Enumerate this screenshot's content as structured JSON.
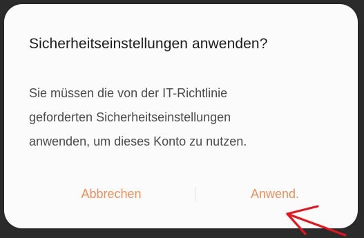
{
  "dialog": {
    "title": "Sicherheitseinstellungen anwenden?",
    "message_lines": [
      "Sie müssen die von der IT-Richtlinie",
      "geforderten Sicherheitseinstellungen",
      "anwenden, um dieses Konto zu nutzen."
    ],
    "cancel_label": "Abbrechen",
    "apply_label": "Anwend."
  },
  "colors": {
    "accent": "#ec8f58",
    "annotation_arrow": "#e8141c",
    "dialog_background": "#fbfbfb"
  },
  "icons": {
    "annotation": "red-arrow-icon"
  }
}
